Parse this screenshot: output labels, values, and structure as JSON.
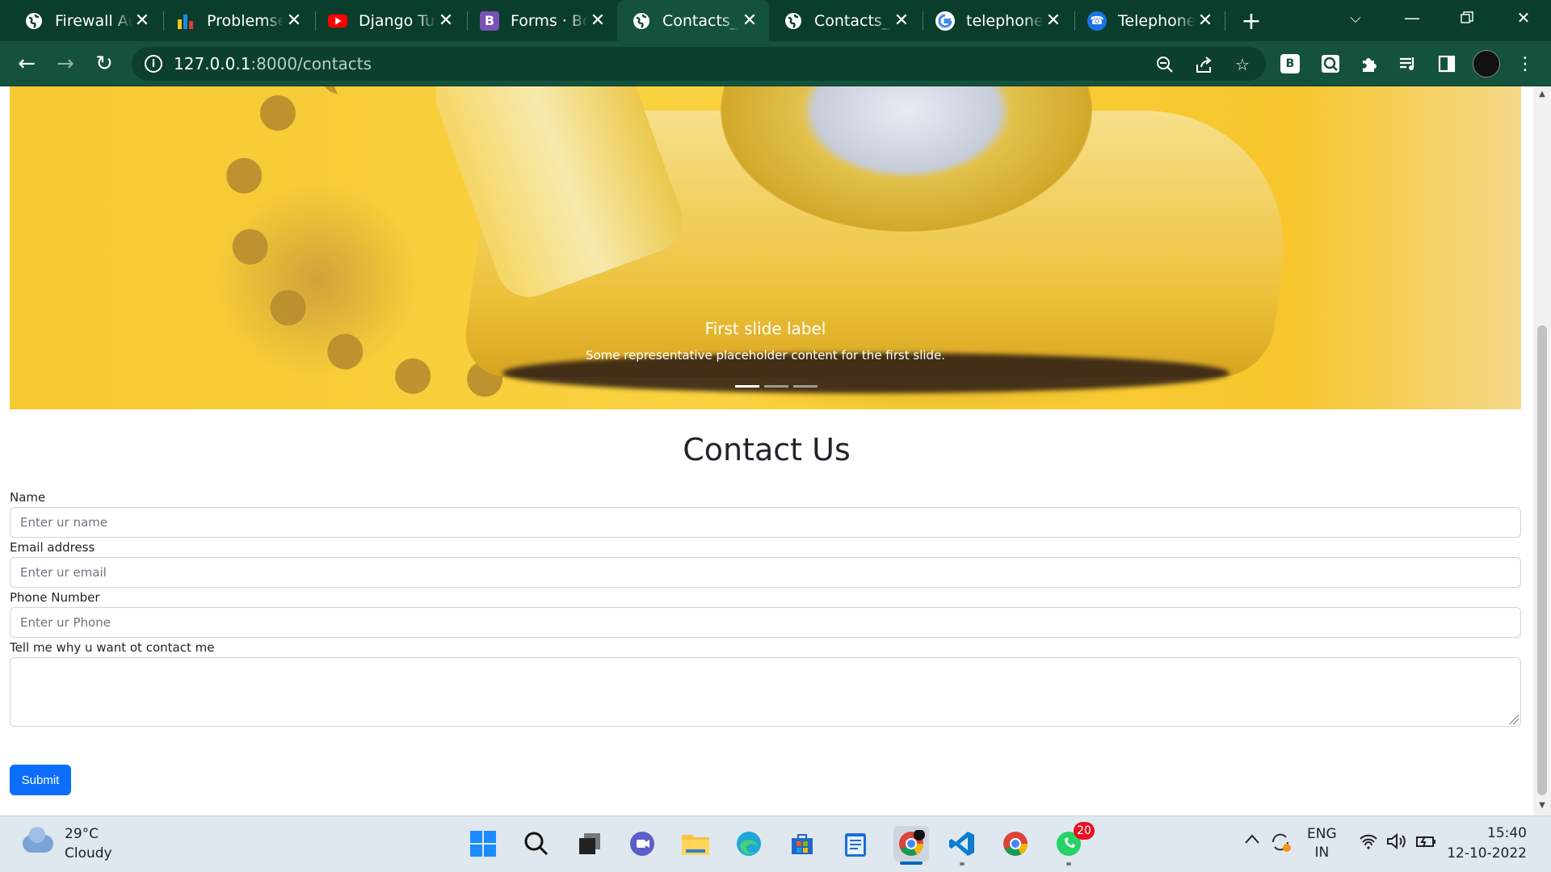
{
  "browser": {
    "tabs": [
      {
        "title": "Firewall Aut",
        "icon": "globe-icon",
        "active": false
      },
      {
        "title": "Problemset",
        "icon": "codeforces-icon",
        "active": false
      },
      {
        "title": "Django Tuto",
        "icon": "youtube-icon",
        "active": false
      },
      {
        "title": "Forms · Boo",
        "icon": "bootstrap-icon",
        "active": false
      },
      {
        "title": "Contacts_Pa",
        "icon": "globe-icon",
        "active": true
      },
      {
        "title": "Contacts_Pa",
        "icon": "globe-icon",
        "active": false
      },
      {
        "title": "telephone",
        "icon": "google-icon",
        "active": false
      },
      {
        "title": "Telephone I",
        "icon": "telephone-icon",
        "active": false
      }
    ],
    "url_host": "127.0.0.1",
    "url_path": ":8000/contacts",
    "colors": {
      "chrome_frame": "#0b3d2c",
      "toolbar": "#14523c"
    }
  },
  "page": {
    "carousel": {
      "caption_title": "First slide label",
      "caption_text": "Some representative placeholder content for the first slide.",
      "indicator_count": 3,
      "active_indicator": 0
    },
    "heading": "Contact Us",
    "form": {
      "name_label": "Name",
      "name_placeholder": "Enter ur name",
      "email_label": "Email address",
      "email_placeholder": "Enter ur email",
      "phone_label": "Phone Number",
      "phone_placeholder": "Enter ur Phone",
      "reason_label": "Tell me why u want ot contact me",
      "submit_label": "Submit"
    },
    "colors": {
      "primary": "#0d6efd",
      "carousel_bg": "#f6c832"
    }
  },
  "taskbar": {
    "weather_temp": "29°C",
    "weather_desc": "Cloudy",
    "whatsapp_badge": "20",
    "lang_line1": "ENG",
    "lang_line2": "IN",
    "time": "15:40",
    "date": "12-10-2022"
  }
}
